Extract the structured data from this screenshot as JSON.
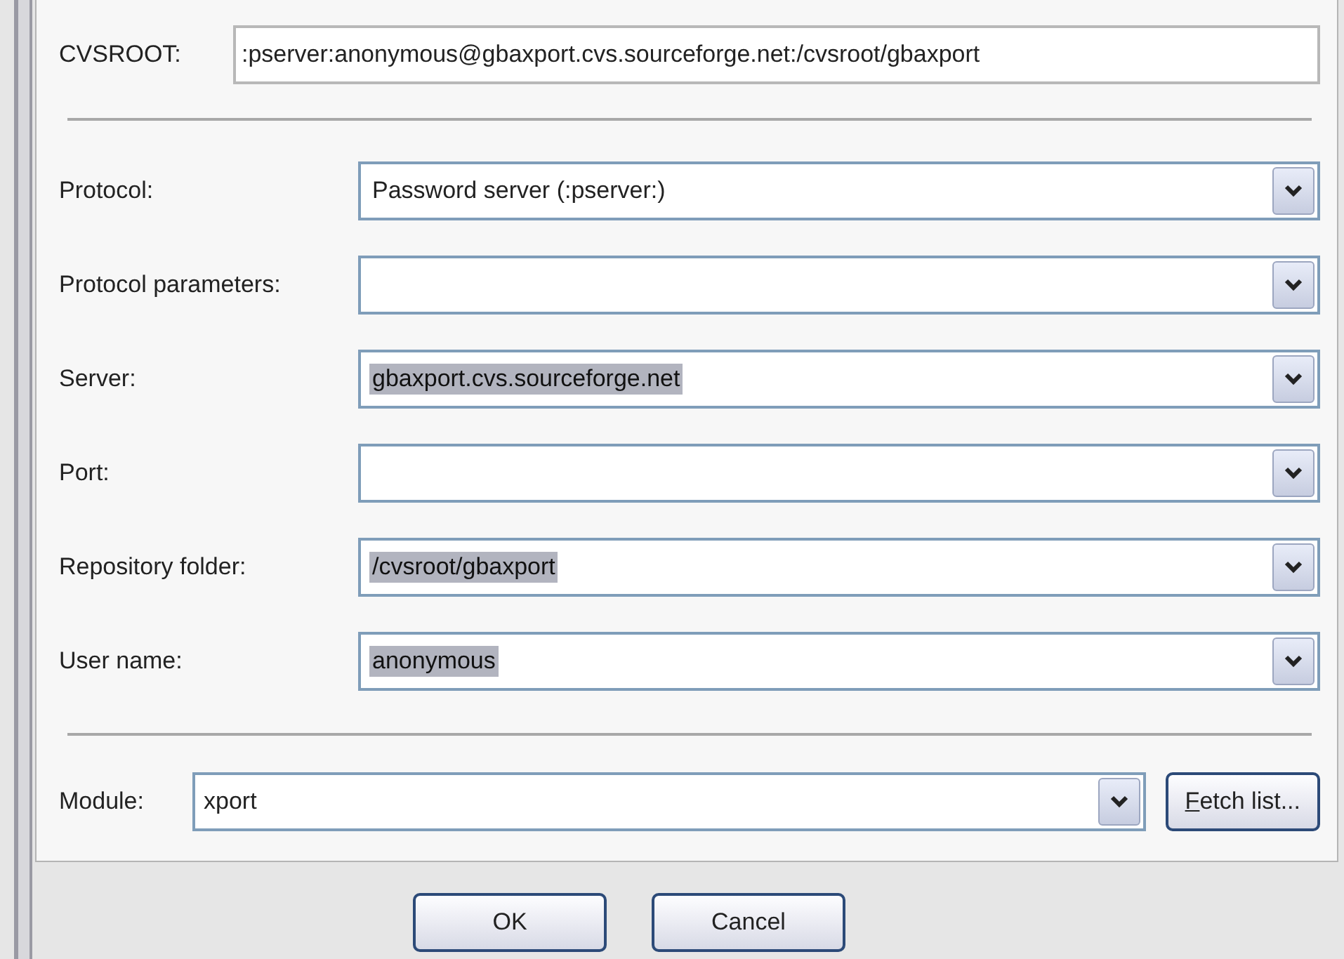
{
  "cvsroot": {
    "label": "CVSROOT:",
    "value": ":pserver:anonymous@gbaxport.cvs.sourceforge.net:/cvsroot/gbaxport"
  },
  "fields": [
    {
      "label": "Protocol:",
      "value": "Password server (:pserver:)",
      "text_selected": false
    },
    {
      "label": "Protocol parameters:"
    },
    {
      "label": "Server:",
      "value": "gbaxport.cvs.sourceforge.net",
      "text_selected": true
    },
    {
      "label": "Port:"
    },
    {
      "label": "Repository folder:",
      "value": "/cvsroot/gbaxport",
      "text_selected": true
    },
    {
      "label": "User name:",
      "value": "anonymous",
      "text_selected": true
    }
  ],
  "module": {
    "label": "Module:",
    "value": "xport",
    "button": {
      "label": "Fetch list...",
      "first_letter_underlined": true
    }
  },
  "buttons": [
    "OK",
    "Cancel"
  ]
}
